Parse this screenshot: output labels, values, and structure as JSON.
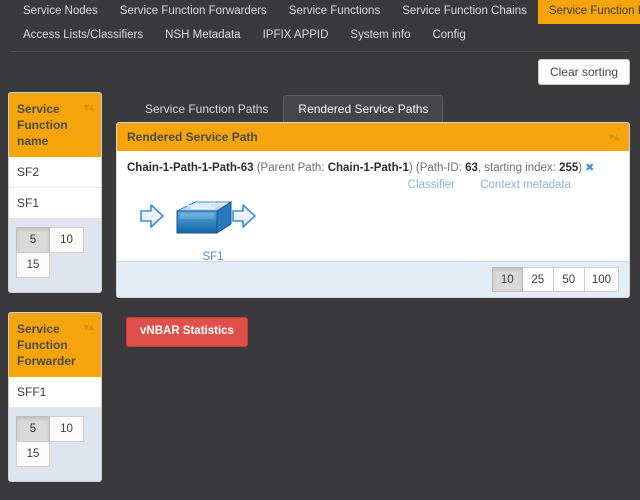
{
  "nav": {
    "row1": [
      {
        "label": "Service Nodes",
        "active": false
      },
      {
        "label": "Service Function Forwarders",
        "active": false
      },
      {
        "label": "Service Functions",
        "active": false
      },
      {
        "label": "Service Function Chains",
        "active": false
      },
      {
        "label": "Service Function Paths",
        "active": true
      }
    ],
    "row2": [
      {
        "label": "Access Lists/Classifiers",
        "active": false
      },
      {
        "label": "NSH Metadata",
        "active": false
      },
      {
        "label": "IPFIX APPID",
        "active": false
      },
      {
        "label": "System info",
        "active": false
      },
      {
        "label": "Config",
        "active": false
      }
    ]
  },
  "toolbar": {
    "clear_sorting_label": "Clear sorting"
  },
  "sidebar": {
    "panels": [
      {
        "title": "Service Function name",
        "sort_icon": "sort-icon",
        "rows": [
          "SF2",
          "SF1"
        ],
        "pager": [
          {
            "label": "5",
            "active": true
          },
          {
            "label": "10",
            "active": false
          },
          {
            "label": "15",
            "active": false
          }
        ]
      },
      {
        "title": "Service Function Forwarder",
        "sort_icon": "sort-icon",
        "rows": [
          "SFF1"
        ],
        "pager": [
          {
            "label": "5",
            "active": true
          },
          {
            "label": "10",
            "active": false
          },
          {
            "label": "15",
            "active": false
          }
        ]
      }
    ]
  },
  "main": {
    "tabs": [
      {
        "label": "Service Function Paths",
        "active": false
      },
      {
        "label": "Rendered Service Paths",
        "active": true
      }
    ],
    "card": {
      "header": "Rendered Service Path",
      "sort_icon": "sort-icon",
      "path": {
        "name": "Chain-1-Path-1-Path-63",
        "parent_prefix": " (Parent Path: ",
        "parent_path": "Chain-1-Path-1",
        "mid": ") (Path-ID: ",
        "path_id": "63",
        "index_prefix": ", starting index: ",
        "starting_index": "255",
        "suffix": ")",
        "close_icon": "✖"
      },
      "links": [
        {
          "label": "Classifier"
        },
        {
          "label": "Context metadata"
        }
      ],
      "diagram": {
        "node_label": "SF1",
        "node_icon": "service-function-switch-icon",
        "in_arrow_icon": "arrow-right-icon",
        "out_arrow_icon": "arrow-right-icon"
      },
      "pager": [
        {
          "label": "10",
          "active": true
        },
        {
          "label": "25",
          "active": false
        },
        {
          "label": "50",
          "active": false
        },
        {
          "label": "100",
          "active": false
        }
      ]
    },
    "vnbar_label": "vNBAR Statistics"
  },
  "colors": {
    "accent_orange": "#f5a50b",
    "background_dark": "#3a3a3c",
    "danger_red": "#e0504a",
    "link_blue": "#8ab4d8",
    "node_blue": "#4a90d9"
  }
}
